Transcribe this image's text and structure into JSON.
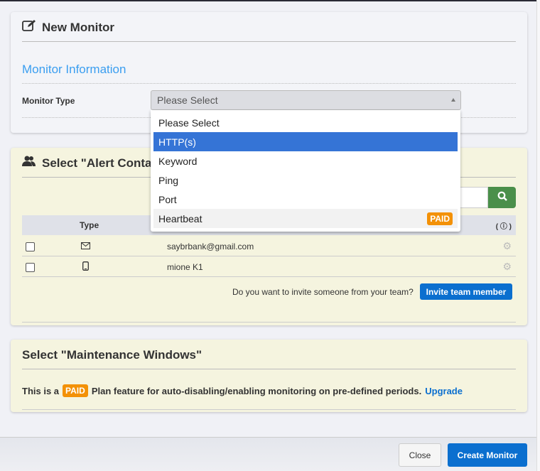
{
  "modal": {
    "title": "New Monitor"
  },
  "monitor_info": {
    "heading": "Monitor Information",
    "type_label": "Monitor Type",
    "select_value": "Please Select",
    "options": [
      {
        "label": "Please Select"
      },
      {
        "label": "HTTP(s)"
      },
      {
        "label": "Keyword"
      },
      {
        "label": "Ping"
      },
      {
        "label": "Port"
      },
      {
        "label": "Heartbeat",
        "badge": "PAID"
      }
    ]
  },
  "alert_contacts": {
    "title": "Select \"Alert Contacts\"",
    "col_type": "Type",
    "info_col": "( ⓘ )",
    "rows": [
      {
        "type": "email",
        "value": "saybrbank@gmail.com"
      },
      {
        "type": "mobile",
        "value": "mione K1"
      }
    ],
    "invite_text": "Do you want to invite someone from your team?",
    "invite_button": "Invite team member"
  },
  "maintenance": {
    "title": "Select \"Maintenance Windows\"",
    "text_pre": "This is a",
    "badge": "PAID",
    "text_post": "Plan feature for auto-disabling/enabling monitoring on pre-defined periods.",
    "upgrade": "Upgrade"
  },
  "footer": {
    "close": "Close",
    "create": "Create Monitor"
  },
  "colors": {
    "accent": "#0b6fcf",
    "paid": "#f39106",
    "selected": "#3574d6"
  }
}
